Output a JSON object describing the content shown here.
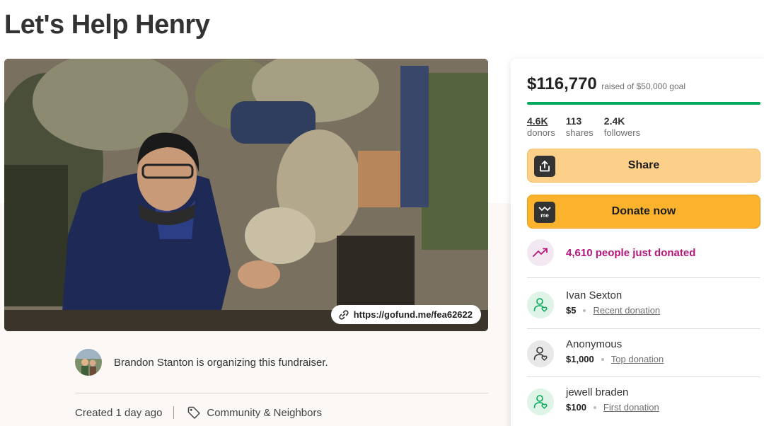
{
  "page": {
    "title": "Let's Help Henry"
  },
  "hero": {
    "share_link": "https://gofund.me/fea62622"
  },
  "organizer": {
    "text": "Brandon Stanton is organizing this fundraiser."
  },
  "meta": {
    "created": "Created 1 day ago",
    "category": "Community & Neighbors"
  },
  "donation_card": {
    "raised_amount": "$116,770",
    "goal_text": "raised of $50,000 goal",
    "progress_fraction": 1.0,
    "accent_color": "#02a95c",
    "stats": [
      {
        "value": "4.6K",
        "label": "donors"
      },
      {
        "value": "113",
        "label": "shares"
      },
      {
        "value": "2.4K",
        "label": "followers"
      }
    ],
    "share_label": "Share",
    "donate_label": "Donate now",
    "recent_activity": "4,610 people just donated",
    "donors": [
      {
        "name": "Ivan Sexton",
        "amount": "$5",
        "type": "Recent donation"
      },
      {
        "name": "Anonymous",
        "amount": "$1,000",
        "type": "Top donation"
      },
      {
        "name": "jewell braden",
        "amount": "$100",
        "type": "First donation"
      }
    ]
  }
}
